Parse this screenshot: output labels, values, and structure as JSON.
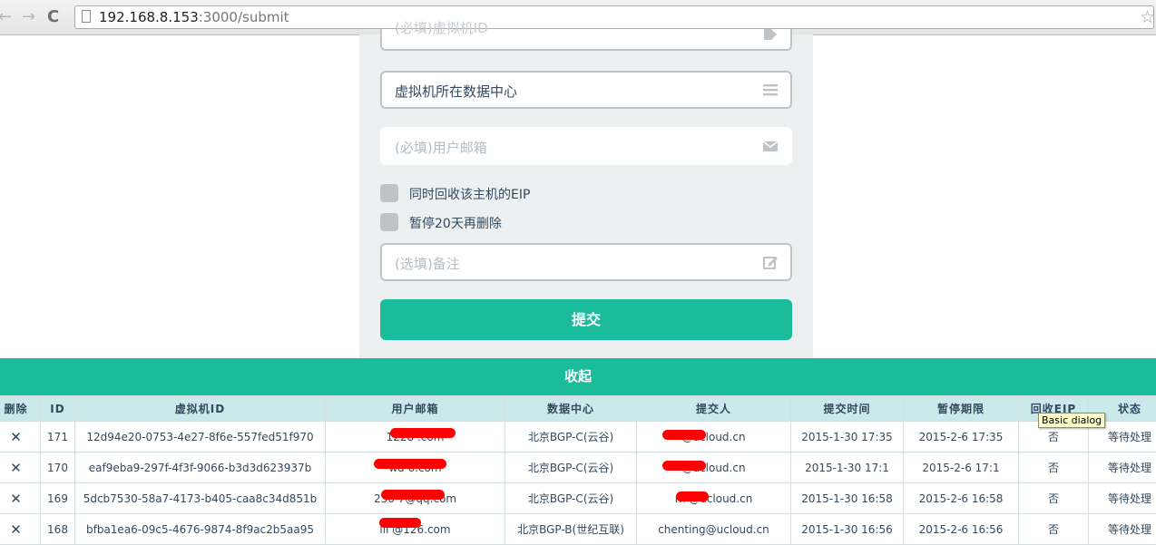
{
  "browser": {
    "url_host": "192.168.8.153",
    "url_rest": ":3000/submit"
  },
  "form": {
    "vm_id_placeholder": "(必填)虚拟机ID",
    "datacenter_value": "虚拟机所在数据中心",
    "email_placeholder": "(必填)用户邮箱",
    "recycle_eip_label": "同时回收该主机的EIP",
    "pause_label": "暂停20天再删除",
    "note_placeholder": "(选填)备注",
    "submit_label": "提交"
  },
  "collapse_label": "收起",
  "table": {
    "headers": [
      "删除",
      "ID",
      "虚拟机ID",
      "用户邮箱",
      "数据中心",
      "提交人",
      "提交时间",
      "暂停期限",
      "回收EIP",
      "状态"
    ],
    "rows": [
      {
        "del": "✕",
        "id": "171",
        "vm": "12d94e20-0753-4e27-8f6e-557fed51f970",
        "email": "1228      .com",
        "dc": "北京BGP-C(云谷)",
        "submitter": "       @ucloud.cn",
        "time": "2015-1-30 17:35",
        "pause": "2015-2-6 17:35",
        "eip": "否",
        "status": "等待处理"
      },
      {
        "del": "✕",
        "id": "170",
        "vm": "eaf9eba9-297f-4f3f-9066-b3d3d623937b",
        "email": "wa       6.com",
        "dc": "北京BGP-C(云谷)",
        "submitter": "       @ucloud.cn",
        "time": "2015-1-30 17:1",
        "pause": "2015-2-6 17:1",
        "eip": "否",
        "status": "等待处理"
      },
      {
        "del": "✕",
        "id": "169",
        "vm": "5dcb7530-58a7-4173-b405-caa8c34d851b",
        "email": "236     7@qq.com",
        "dc": "北京BGP-C(云谷)",
        "submitter": "m       @ucloud.cn",
        "time": "2015-1-30 16:58",
        "pause": "2015-2-6 16:58",
        "eip": "否",
        "status": "等待处理"
      },
      {
        "del": "✕",
        "id": "168",
        "vm": "bfba1ea6-09c5-4676-9874-8f9ac2b5aa95",
        "email": "lli        @126.com",
        "dc": "北京BGP-B(世纪互联)",
        "submitter": "chenting@ucloud.cn",
        "time": "2015-1-30 16:56",
        "pause": "2015-2-6 16:56",
        "eip": "否",
        "status": "等待处理"
      }
    ]
  },
  "tooltip": "Basic dialog",
  "colors": {
    "accent": "#1abc9c",
    "header_bg": "#c9e9eb",
    "card_bg": "#ecf0f1",
    "redaction": "#ff0000"
  },
  "icons": [
    "back-arrow-icon",
    "forward-arrow-icon",
    "reload-icon",
    "page-icon",
    "bookmark-star-icon",
    "tag-icon",
    "list-icon",
    "envelope-icon",
    "edit-icon",
    "delete-x-icon"
  ]
}
